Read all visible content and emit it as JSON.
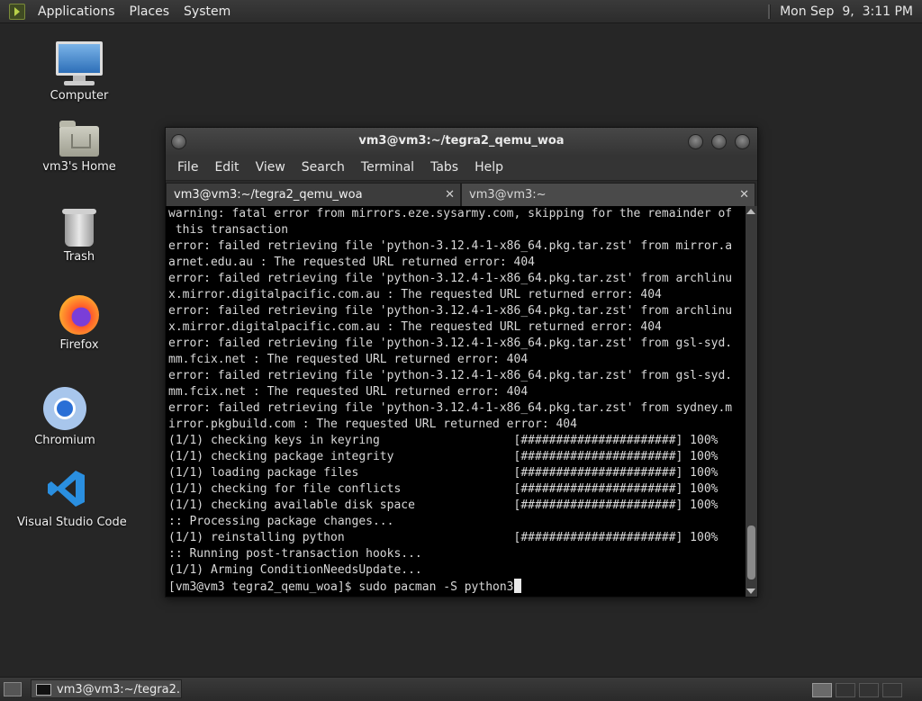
{
  "top_panel": {
    "menus": [
      "Applications",
      "Places",
      "System"
    ],
    "clock": "Mon Sep  9,  3:11 PM"
  },
  "desktop_icons": {
    "computer": "Computer",
    "home": "vm3's Home",
    "trash": "Trash",
    "firefox": "Firefox",
    "chromium": "Chromium",
    "vscode": "Visual Studio Code"
  },
  "terminal": {
    "title": "vm3@vm3:~/tegra2_qemu_woa",
    "menus": [
      "File",
      "Edit",
      "View",
      "Search",
      "Terminal",
      "Tabs",
      "Help"
    ],
    "tabs": [
      {
        "label": "vm3@vm3:~/tegra2_qemu_woa",
        "close": "✕"
      },
      {
        "label": "vm3@vm3:~",
        "close": "✕"
      }
    ],
    "lines": [
      "warning: fatal error from mirrors.eze.sysarmy.com, skipping for the remainder of",
      " this transaction",
      "error: failed retrieving file 'python-3.12.4-1-x86_64.pkg.tar.zst' from mirror.a",
      "arnet.edu.au : The requested URL returned error: 404",
      "error: failed retrieving file 'python-3.12.4-1-x86_64.pkg.tar.zst' from archlinu",
      "x.mirror.digitalpacific.com.au : The requested URL returned error: 404",
      "error: failed retrieving file 'python-3.12.4-1-x86_64.pkg.tar.zst' from archlinu",
      "x.mirror.digitalpacific.com.au : The requested URL returned error: 404",
      "error: failed retrieving file 'python-3.12.4-1-x86_64.pkg.tar.zst' from gsl-syd.",
      "mm.fcix.net : The requested URL returned error: 404",
      "error: failed retrieving file 'python-3.12.4-1-x86_64.pkg.tar.zst' from gsl-syd.",
      "mm.fcix.net : The requested URL returned error: 404",
      "error: failed retrieving file 'python-3.12.4-1-x86_64.pkg.tar.zst' from sydney.m",
      "irror.pkgbuild.com : The requested URL returned error: 404",
      "(1/1) checking keys in keyring                   [######################] 100%",
      "(1/1) checking package integrity                 [######################] 100%",
      "(1/1) loading package files                      [######################] 100%",
      "(1/1) checking for file conflicts                [######################] 100%",
      "(1/1) checking available disk space              [######################] 100%",
      ":: Processing package changes...",
      "(1/1) reinstalling python                        [######################] 100%",
      ":: Running post-transaction hooks...",
      "(1/1) Arming ConditionNeedsUpdate..."
    ],
    "prompt": "[vm3@vm3 tegra2_qemu_woa]$ sudo pacman -S python3"
  },
  "bottom_panel": {
    "task_label": "vm3@vm3:~/tegra2..."
  }
}
